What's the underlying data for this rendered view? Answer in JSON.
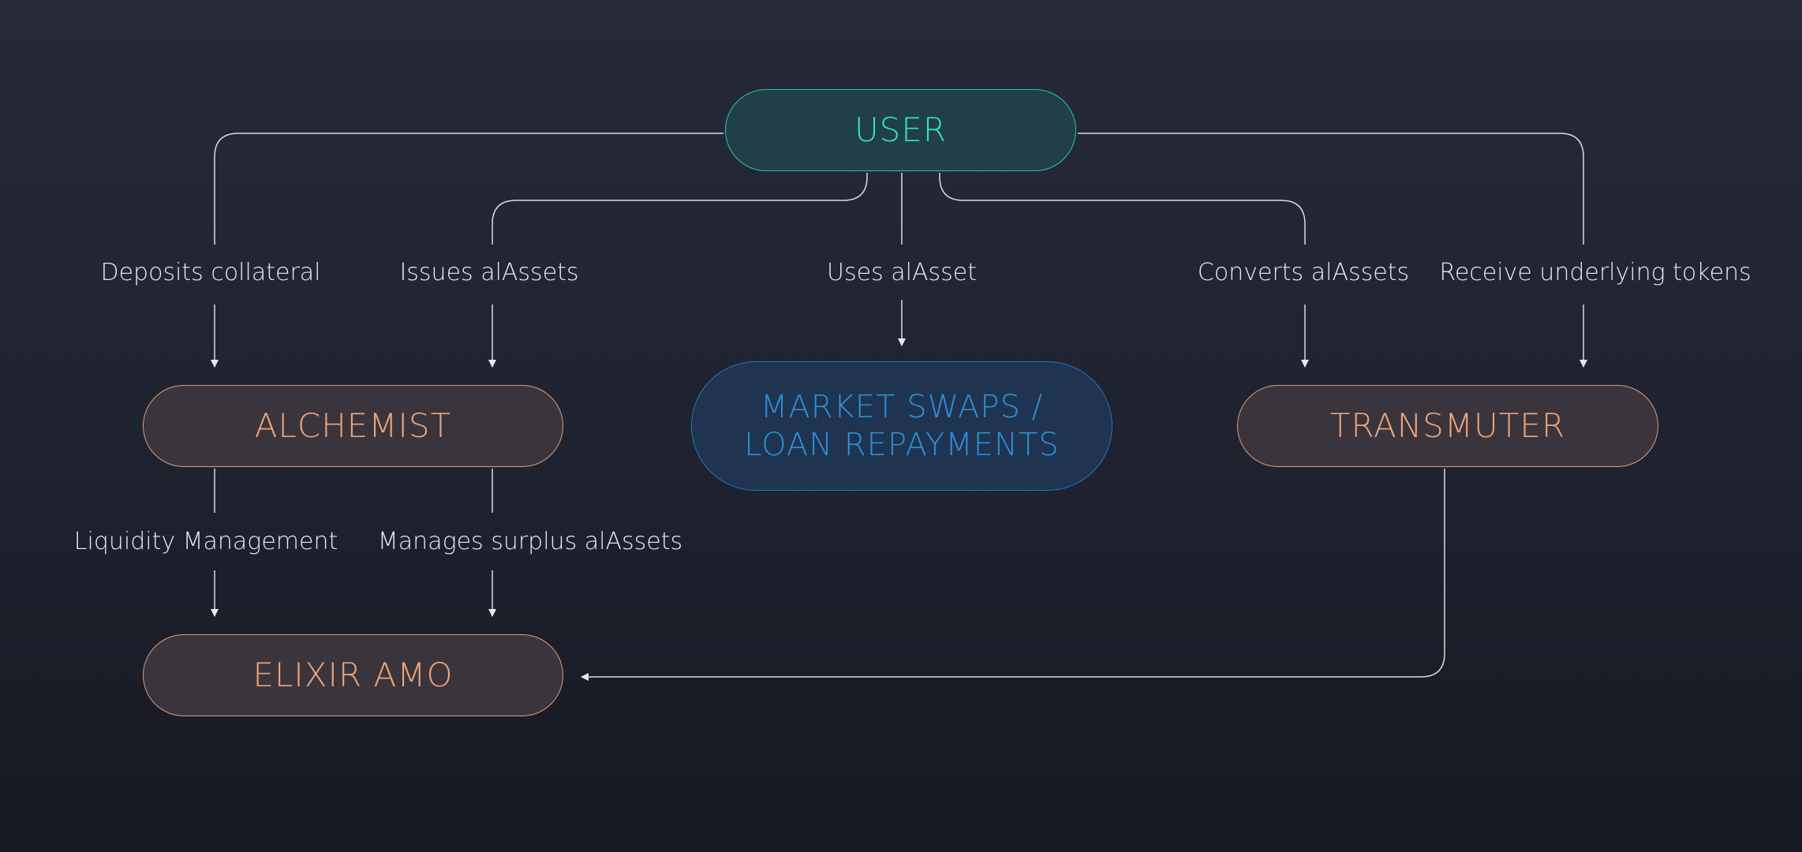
{
  "nodes": {
    "user": "USER",
    "alchemist": "ALCHEMIST",
    "market_line1": "MARKET SWAPS /",
    "market_line2": "LOAN REPAYMENTS",
    "transmuter": "TRANSMUTER",
    "elixir": "ELIXIR AMO"
  },
  "edges": {
    "deposits_collateral": "Deposits collateral",
    "issues_alassets": "Issues alAssets",
    "uses_alasset": "Uses alAsset",
    "converts_alassets": "Converts alAssets",
    "receive_underlying": "Receive underlying tokens",
    "liquidity_management": "Liquidity Management",
    "manages_surplus": "Manages surplus alAssets"
  },
  "colors": {
    "background": "#22252f",
    "user_accent": "#2ee6bd",
    "warm_accent": "#efa57c",
    "market_accent": "#2e8fd6",
    "connector": "#d9dbe2"
  }
}
